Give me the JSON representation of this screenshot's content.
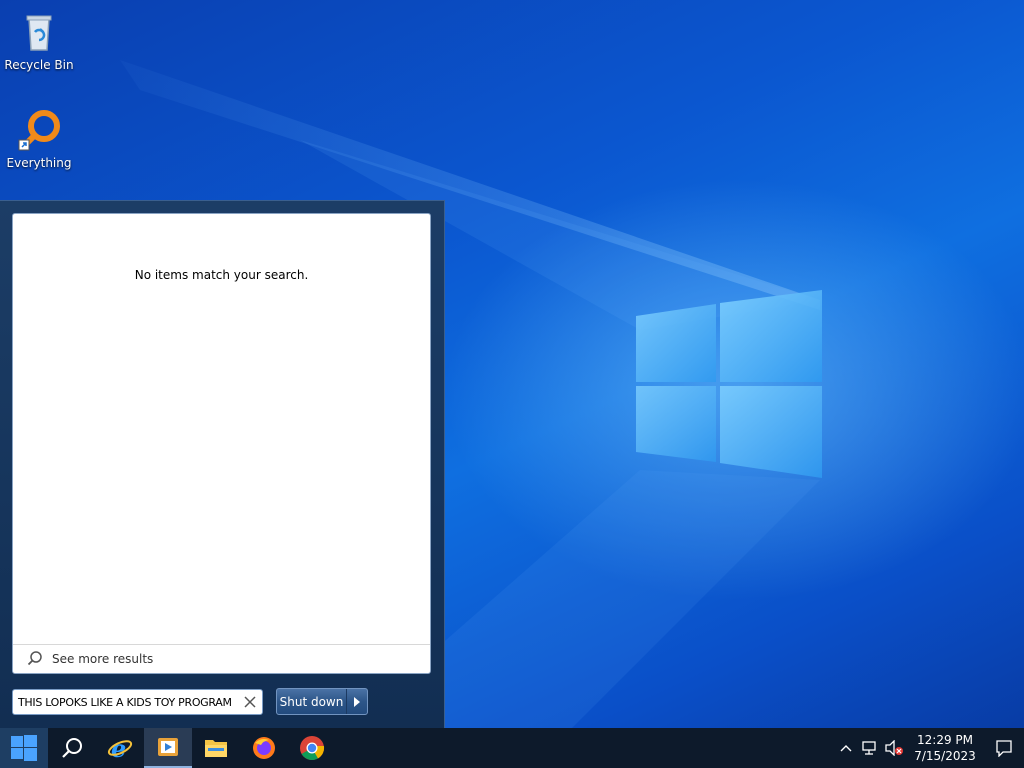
{
  "desktop": {
    "icons": [
      {
        "label": "Recycle Bin",
        "icon": "recycle-bin-icon"
      },
      {
        "label": "Everything",
        "icon": "everything-search-icon"
      }
    ]
  },
  "start_menu": {
    "no_results_text": "No items match your search.",
    "see_more_label": "See more results",
    "search_value": "THIS LOPOKS LIKE A KIDS TOY PROGRAM",
    "shutdown_label": "Shut down"
  },
  "taskbar": {
    "apps": [
      {
        "name": "Start",
        "icon": "windows-start-icon"
      },
      {
        "name": "Search",
        "icon": "search-icon"
      },
      {
        "name": "Internet Explorer",
        "icon": "internet-explorer-icon"
      },
      {
        "name": "Media Player",
        "icon": "media-player-icon"
      },
      {
        "name": "File Explorer",
        "icon": "folder-icon"
      },
      {
        "name": "Firefox",
        "icon": "firefox-icon"
      },
      {
        "name": "Chrome",
        "icon": "chrome-icon"
      }
    ],
    "tray": {
      "time": "12:29 PM",
      "date": "7/15/2023"
    }
  },
  "colors": {
    "taskbar": "#0d1a2b",
    "start_menu": "#16355c",
    "desktop_accent": "#0b57d0"
  }
}
